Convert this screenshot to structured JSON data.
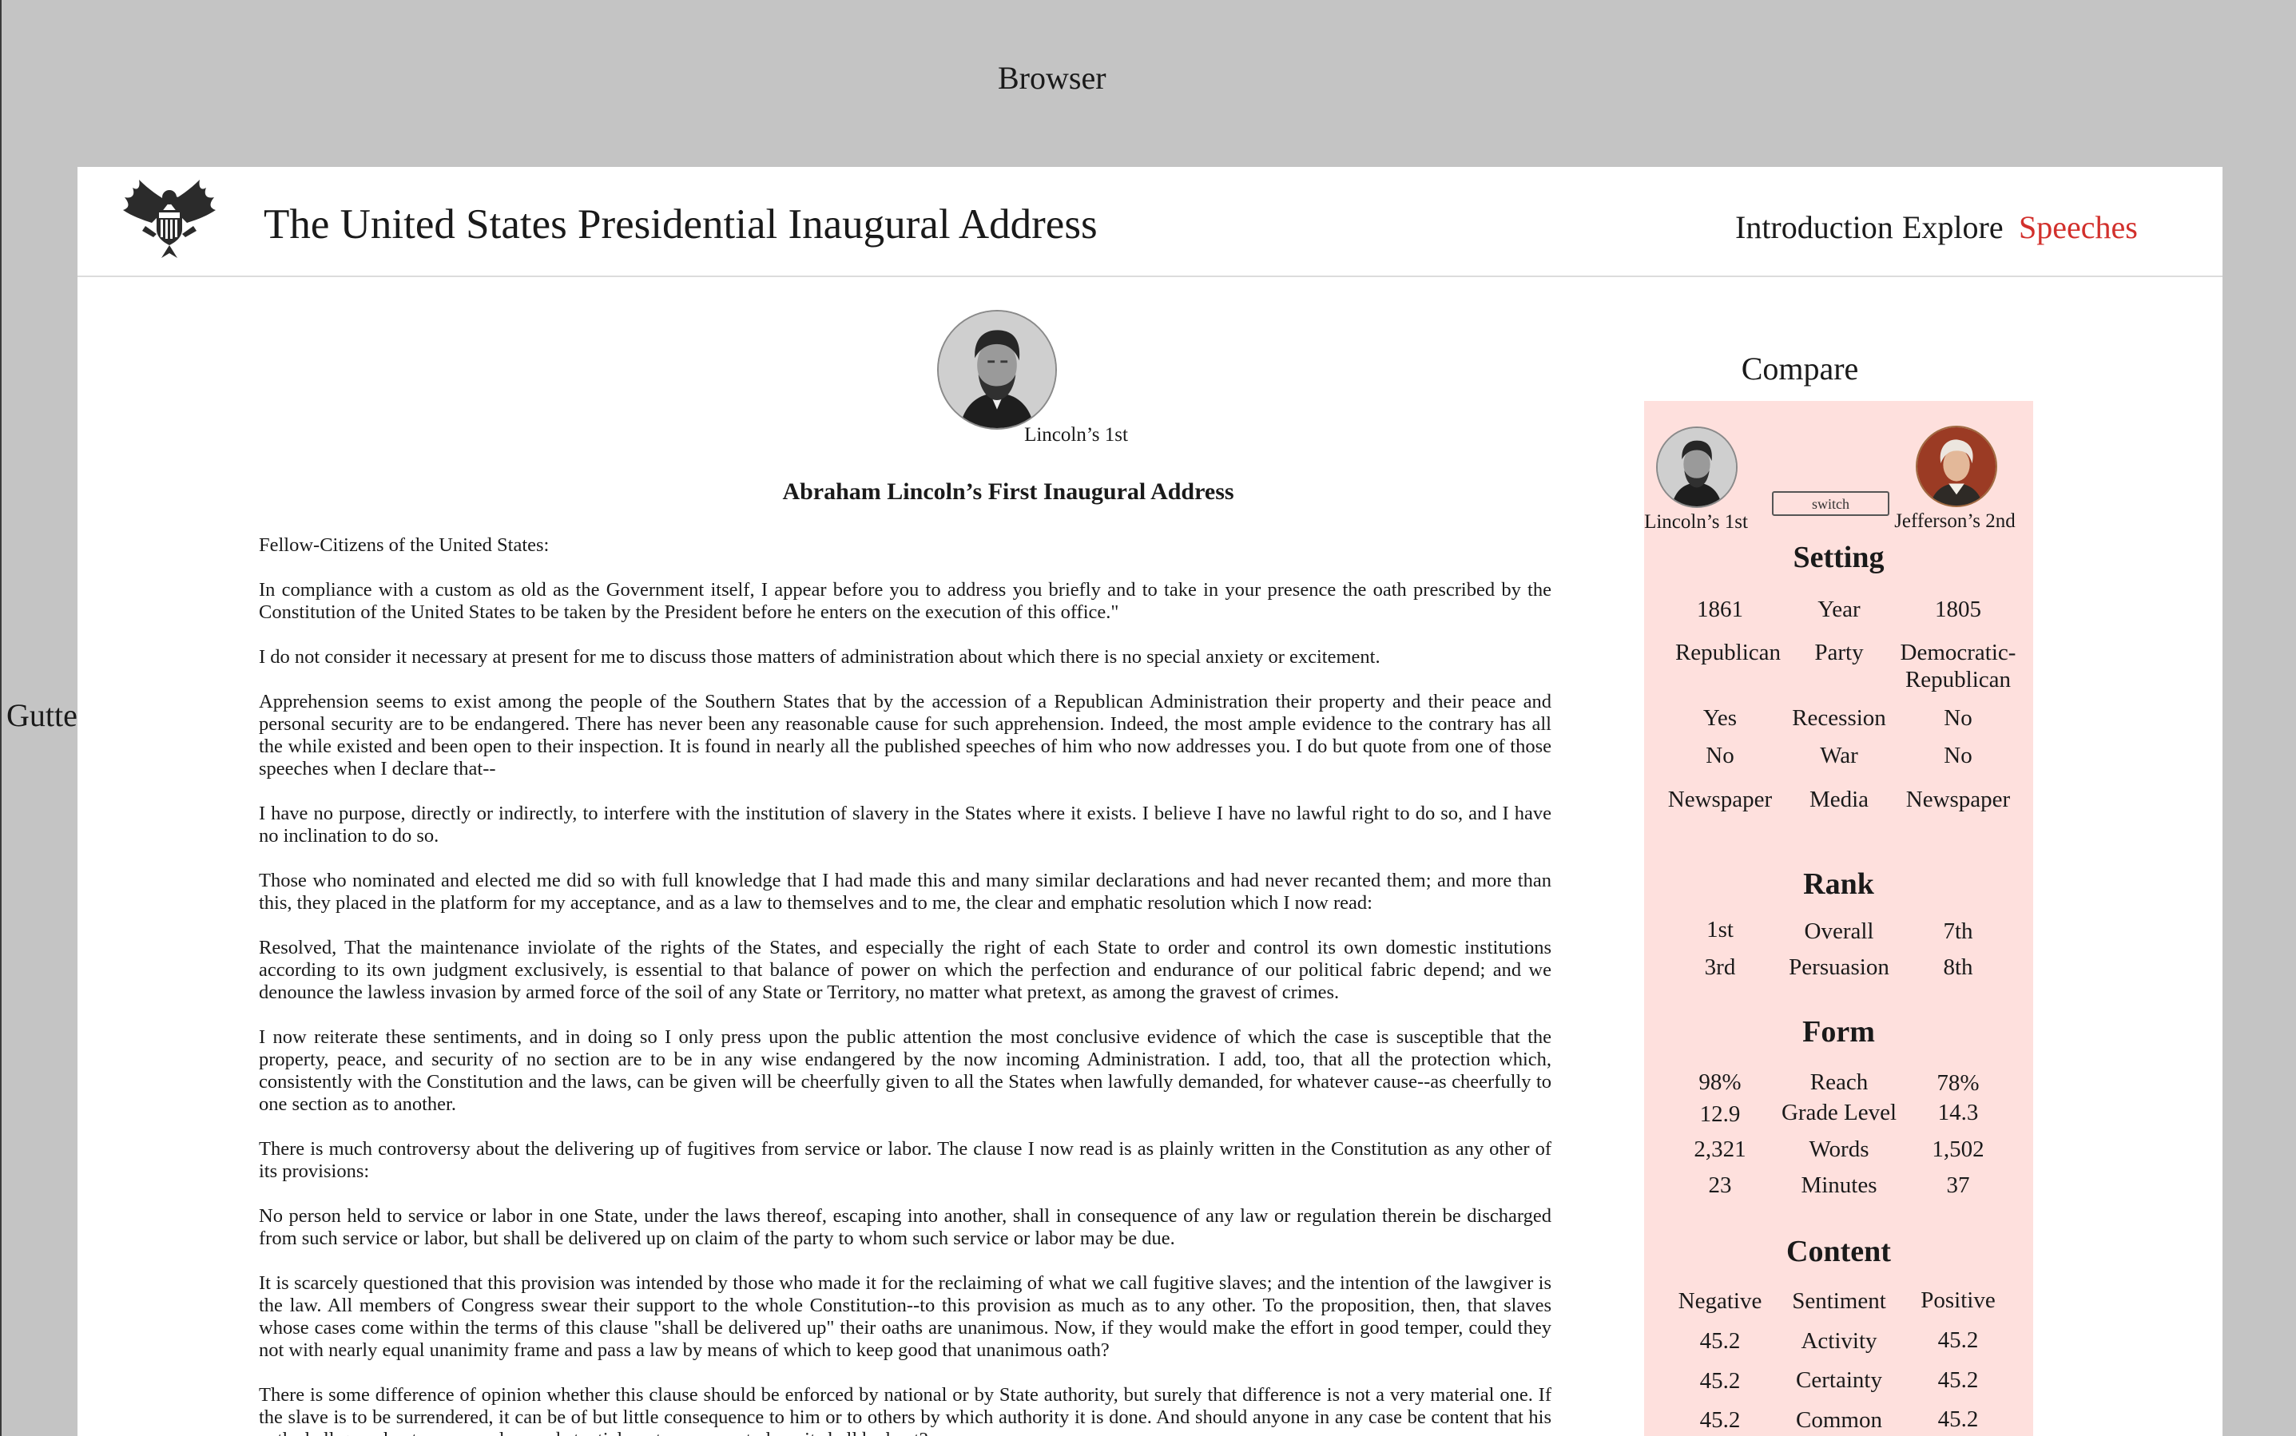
{
  "annotations": {
    "browser": "Browser",
    "gutter": "Gutter"
  },
  "header": {
    "title": "The United States Presidential Inaugural Address",
    "nav": [
      "Introduction",
      "Explore",
      "Speeches"
    ],
    "active_nav": "Speeches"
  },
  "main": {
    "portrait_caption": "Lincoln’s 1st",
    "speech_title": "Abraham Lincoln’s First Inaugural Address",
    "paragraphs": [
      "Fellow-Citizens of the United States:",
      "In compliance with a custom as old as the Government itself, I appear before you to address you briefly and to take in your presence the oath prescribed by the Constitution of the United States to be taken by the President before he enters on the execution of this office.\"",
      "I do not consider it necessary at present for me to discuss those matters of administration about which there is no special anxiety or excitement.",
      "Apprehension seems to exist among the people of the Southern States that by the accession of a Republican Administration their property and their peace and personal security are to be endangered. There has never been any reasonable cause for such apprehension. Indeed, the most ample evidence to the contrary has all the while existed and been open to their inspection. It is found in nearly all the published speeches of him who now addresses you. I do but quote from one of those speeches when I declare that--",
      "I have no purpose, directly or indirectly, to interfere with the institution of slavery in the States where it exists. I believe I have no lawful right to do so, and I have no inclination to do so.",
      "Those who nominated and elected me did so with full knowledge that I had made this and many similar declarations and had never recanted them; and more than this, they placed in the platform for my acceptance, and as a law to themselves and to me, the clear and emphatic resolution which I now read:",
      "Resolved, That the maintenance inviolate of the rights of the States, and especially the right of each State to order and control its own domestic institutions according to its own judgment exclusively, is essential to that balance of power on which the perfection and endurance of our political fabric depend; and we denounce the lawless invasion by armed force of the soil of any State or Territory, no matter what pretext, as among the gravest of crimes.",
      "I now reiterate these sentiments, and in doing so I only press upon the public attention the most conclusive evidence of which the case is susceptible that the property, peace, and security of no section are to be in any wise endangered by the now incoming Administration. I add, too, that all the protection which, consistently with the Constitution and the laws, can be given will be cheerfully given to all the States when lawfully demanded, for whatever cause--as cheerfully to one section as to another.",
      "There is much controversy about the delivering up of fugitives from service or labor. The clause I now read is as plainly written in the Constitution as any other of its provisions:",
      "No person held to service or labor in one State, under the laws thereof, escaping into another, shall in consequence of any law or regulation therein be discharged from such service or labor, but shall be delivered up on claim of the party to whom such service or labor may be due.",
      "It is scarcely questioned that this provision was intended by those who made it for the reclaiming of what we call fugitive slaves; and the intention of the lawgiver is the law. All members of Congress swear their support to the whole Constitution--to this provision as much as to any other. To the proposition, then, that slaves whose cases come within the terms of this clause \"shall be delivered up\" their oaths are unanimous. Now, if they would make the effort in good temper, could they not with nearly equal unanimity frame and pass a law by means of which to keep good that unanimous oath?",
      "There is some difference of opinion whether this clause should be enforced by national or by State authority, but surely that difference is not a very material one. If the slave is to be surrendered, it can be of but little consequence to him or to others by which authority it is done. And should anyone in any case be content that his oath shall go unkept on a merely unsubstantial controversy as to how it shall be kept?"
    ]
  },
  "compare": {
    "heading": "Compare",
    "left_caption": "Lincoln’s 1st",
    "right_caption": "Jefferson’s 2nd",
    "switch_label": "switch",
    "sections": {
      "setting": "Setting",
      "rank": "Rank",
      "form": "Form",
      "content": "Content"
    },
    "setting_rows": [
      {
        "left": "1861",
        "label": "Year",
        "right": "1805"
      },
      {
        "left": "Republican",
        "label": "Party",
        "right": "Democratic-Republican"
      },
      {
        "left": "Yes",
        "label": "Recession",
        "right": "No"
      },
      {
        "left": "No",
        "label": "War",
        "right": "No"
      },
      {
        "left": "Newspaper",
        "label": "Media",
        "right": "Newspaper"
      }
    ],
    "rank_rows": [
      {
        "left": "1st",
        "label": "Overall",
        "right": "7th"
      },
      {
        "left": "3rd",
        "label": "Persuasion",
        "right": "8th"
      }
    ],
    "form_rows": [
      {
        "left": "98%",
        "label": "Reach",
        "right": "78%"
      },
      {
        "left": "12.9",
        "label": "Grade Level",
        "right": "14.3"
      },
      {
        "left": "2,321",
        "label": "Words",
        "right": "1,502"
      },
      {
        "left": "23",
        "label": "Minutes",
        "right": "37"
      }
    ],
    "content_rows": [
      {
        "left": "Negative",
        "label": "Sentiment",
        "right": "Positive"
      },
      {
        "left": "45.2",
        "label": "Activity",
        "right": "45.2"
      },
      {
        "left": "45.2",
        "label": "Certainty",
        "right": "45.2"
      },
      {
        "left": "45.2",
        "label": "Common",
        "right": "45.2"
      }
    ]
  }
}
